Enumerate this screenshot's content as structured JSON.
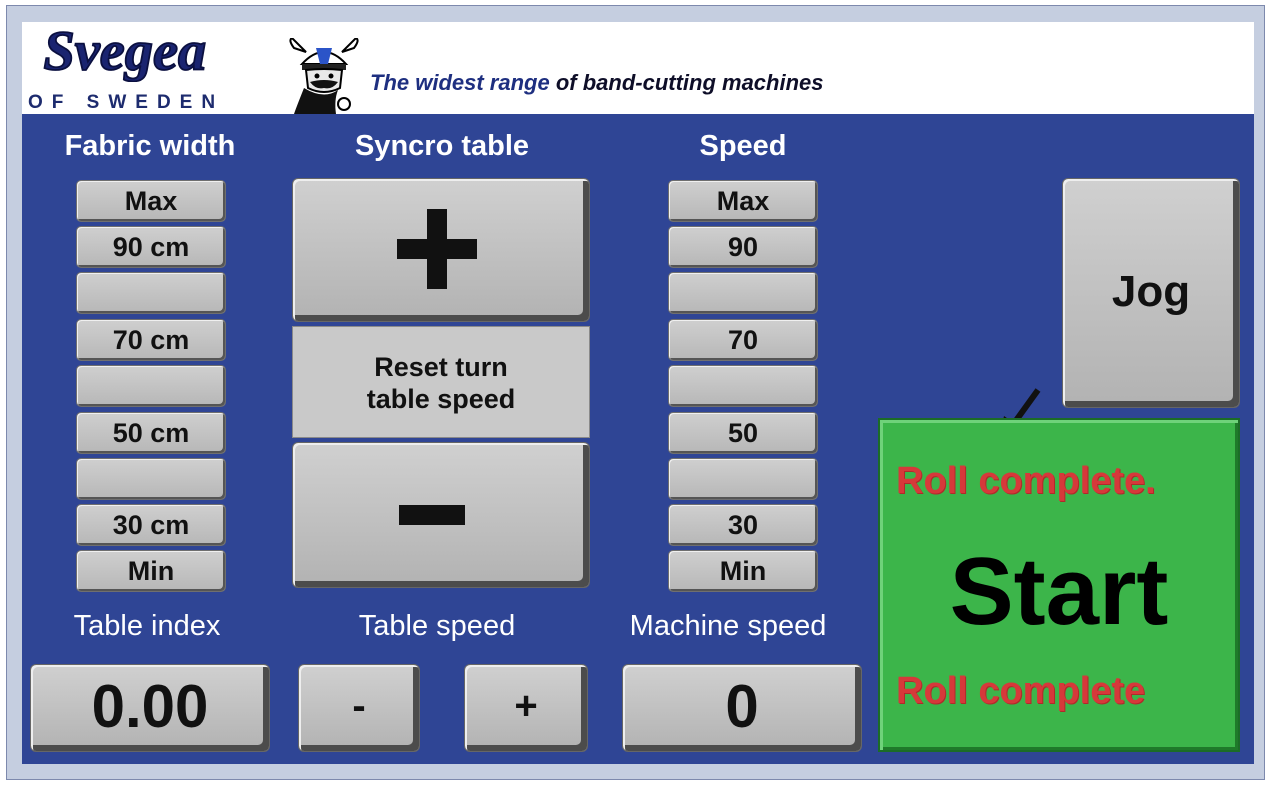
{
  "header": {
    "logo_text": "Svegea",
    "logo_subtext": "OF SWEDEN",
    "tagline_lead": "The widest range",
    "tagline_rest": " of band-cutting machines"
  },
  "fabric_width": {
    "title": "Fabric width",
    "buttons": [
      "Max",
      "90 cm",
      "",
      "70 cm",
      "",
      "50 cm",
      "",
      "30 cm",
      "Min"
    ]
  },
  "syncro_table": {
    "title": "Syncro table",
    "plus_icon": "plus-icon",
    "reset_label_line1": "Reset turn",
    "reset_label_line2": "table speed",
    "minus_icon": "minus-icon"
  },
  "speed": {
    "title": "Speed",
    "buttons": [
      "Max",
      "90",
      "",
      "70",
      "",
      "50",
      "",
      "30",
      "Min"
    ]
  },
  "jog": {
    "label": "Jog"
  },
  "table_index": {
    "title": "Table index",
    "value": "0.00"
  },
  "table_speed": {
    "title": "Table speed",
    "minus_label": "-",
    "plus_label": "+"
  },
  "machine_speed": {
    "title": "Machine speed",
    "value": "0"
  },
  "start_panel": {
    "status_top": "Roll complete.",
    "start_label": "Start",
    "status_bottom": "Roll complete",
    "color": "#3cb54a",
    "status_color": "#d6393a",
    "arrow_icon": "arrow-down-left-icon"
  },
  "colors": {
    "panel": "#2f4595",
    "button": "#c4c4c4"
  }
}
